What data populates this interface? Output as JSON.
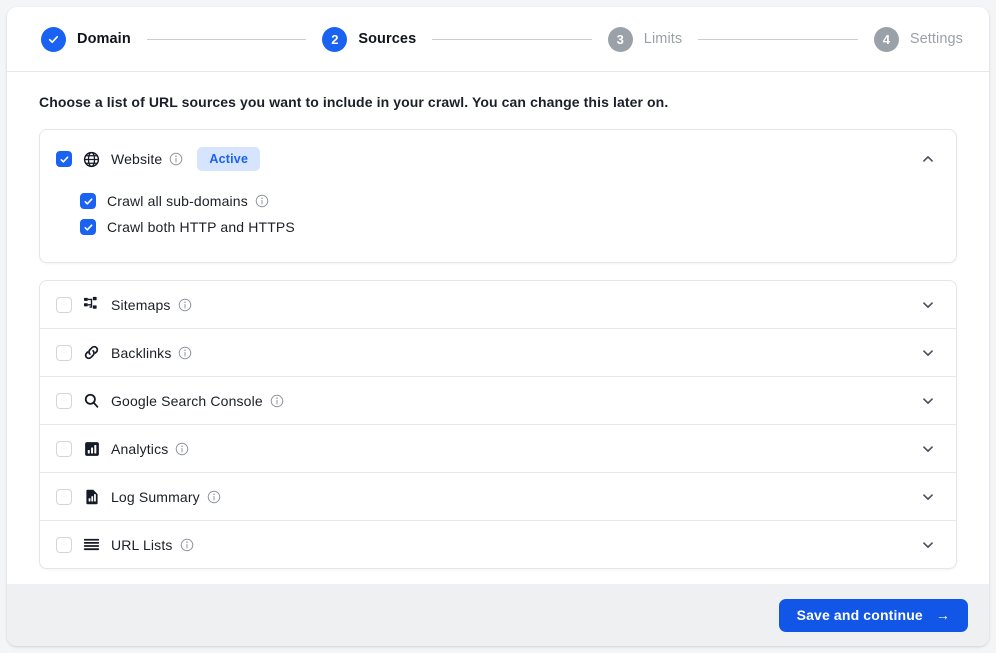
{
  "stepper": {
    "steps": [
      {
        "num": "✓",
        "label": "Domain",
        "state": "done"
      },
      {
        "num": "2",
        "label": "Sources",
        "state": "active"
      },
      {
        "num": "3",
        "label": "Limits",
        "state": "idle"
      },
      {
        "num": "4",
        "label": "Settings",
        "state": "idle"
      }
    ]
  },
  "main": {
    "intro": "Choose a list of URL sources you want to include in your crawl. You can change this later on.",
    "website": {
      "label": "Website",
      "checked": true,
      "badge": "Active",
      "expanded": true,
      "icon": "globe-icon",
      "suboptions": [
        {
          "label": "Crawl all sub-domains",
          "checked": true,
          "info": true
        },
        {
          "label": "Crawl both HTTP and HTTPS",
          "checked": true,
          "info": false
        }
      ]
    },
    "sources": [
      {
        "label": "Sitemaps",
        "checked": false,
        "icon": "sitemap-icon",
        "info": true
      },
      {
        "label": "Backlinks",
        "checked": false,
        "icon": "link-icon",
        "info": true
      },
      {
        "label": "Google Search Console",
        "checked": false,
        "icon": "search-icon",
        "info": true
      },
      {
        "label": "Analytics",
        "checked": false,
        "icon": "bar-chart-icon",
        "info": true
      },
      {
        "label": "Log Summary",
        "checked": false,
        "icon": "document-chart-icon",
        "info": true
      },
      {
        "label": "URL Lists",
        "checked": false,
        "icon": "list-lines-icon",
        "info": true
      }
    ]
  },
  "footer": {
    "save_label": "Save and continue",
    "arrow": "→"
  },
  "colors": {
    "accent": "#1a62f2",
    "button": "#1256e8",
    "badge_bg": "#d6e4fd",
    "muted": "#9ba1a8",
    "footer_bg": "#eef0f2",
    "page_bg": "#f4f5f7"
  }
}
